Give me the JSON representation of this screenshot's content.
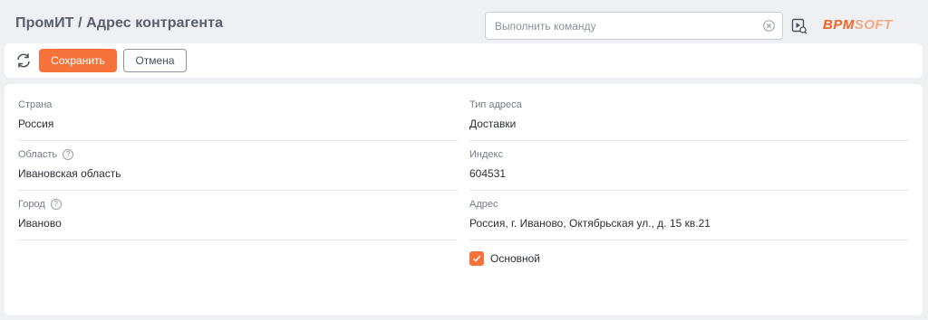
{
  "header": {
    "title": "ПромИТ / Адрес контрагента",
    "command_placeholder": "Выполнить команду",
    "logo_primary": "BPM",
    "logo_secondary": "SOFT"
  },
  "toolbar": {
    "save_label": "Сохранить",
    "cancel_label": "Отмена"
  },
  "form": {
    "country": {
      "label": "Страна",
      "value": "Россия"
    },
    "region": {
      "label": "Область",
      "value": "Ивановская область"
    },
    "city": {
      "label": "Город",
      "value": "Иваново"
    },
    "address_type": {
      "label": "Тип адреса",
      "value": "Доставки"
    },
    "zip": {
      "label": "Индекс",
      "value": "604531"
    },
    "address": {
      "label": "Адрес",
      "value": "Россия, г. Иваново, Октябрьская ул., д. 15 кв.21"
    },
    "primary": {
      "label": "Основной",
      "checked": true
    }
  },
  "icons": {
    "refresh": "refresh-icon",
    "clear": "clear-icon",
    "run": "play-icon",
    "help": "help-icon",
    "check": "checkmark-icon"
  },
  "colors": {
    "accent": "#f5723b",
    "logo": "#f26422",
    "background": "#eef0f4"
  }
}
